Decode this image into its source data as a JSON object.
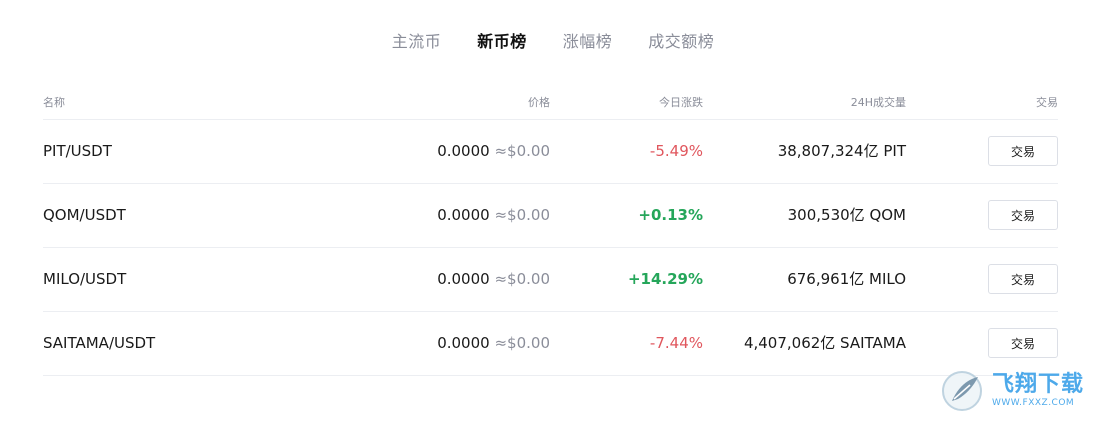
{
  "tabs": [
    {
      "label": "主流币",
      "active": false
    },
    {
      "label": "新币榜",
      "active": true
    },
    {
      "label": "涨幅榜",
      "active": false
    },
    {
      "label": "成交额榜",
      "active": false
    }
  ],
  "table": {
    "headers": {
      "name": "名称",
      "price": "价格",
      "change": "今日涨跌",
      "volume": "24H成交量",
      "action": "交易"
    },
    "rows": [
      {
        "pair": "PIT/USDT",
        "price": "0.0000",
        "usd": "≈$0.00",
        "change": "-5.49%",
        "direction": "down",
        "volume": "38,807,324亿 PIT",
        "action": "交易"
      },
      {
        "pair": "QOM/USDT",
        "price": "0.0000",
        "usd": "≈$0.00",
        "change": "+0.13%",
        "direction": "up",
        "volume": "300,530亿 QOM",
        "action": "交易"
      },
      {
        "pair": "MILO/USDT",
        "price": "0.0000",
        "usd": "≈$0.00",
        "change": "+14.29%",
        "direction": "up",
        "volume": "676,961亿 MILO",
        "action": "交易"
      },
      {
        "pair": "SAITAMA/USDT",
        "price": "0.0000",
        "usd": "≈$0.00",
        "change": "-7.44%",
        "direction": "down",
        "volume": "4,407,062亿 SAITAMA",
        "action": "交易"
      }
    ]
  },
  "colors": {
    "up": "#25a65a",
    "down": "#e0565d",
    "muted": "#8a8d99",
    "watermark": "#3aa0e8"
  },
  "watermark": {
    "title": "飞翔下载",
    "url": "WWW.FXXZ.COM",
    "icon": "feather-logo-icon"
  }
}
